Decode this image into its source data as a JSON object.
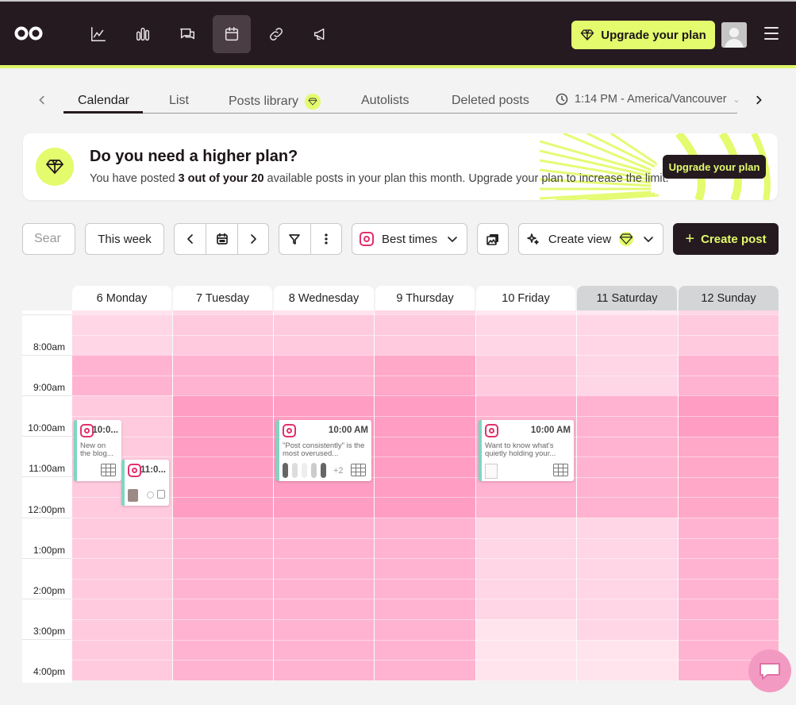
{
  "nav": {
    "upgrade_label": "Upgrade your plan",
    "icons": [
      "analytics-icon",
      "reports-icon",
      "inbox-icon",
      "calendar-icon",
      "link-icon",
      "megaphone-icon"
    ],
    "active": "calendar-icon"
  },
  "tabs": {
    "items": [
      "Calendar",
      "List",
      "Posts library",
      "Autolists",
      "Deleted posts"
    ],
    "active": "Calendar",
    "timezone": "1:14 PM - America/Vancouver"
  },
  "banner": {
    "title": "Do you need a higher plan?",
    "text_before": "You have posted ",
    "text_bold": "3 out of your 20",
    "text_after": " available posts in your plan this month. Upgrade your plan to increase the limit.",
    "button": "Upgrade your plan"
  },
  "toolbar": {
    "search_placeholder": "Sear",
    "range": "This week",
    "best_times": "Best times",
    "create_view": "Create view",
    "create_post": "Create post"
  },
  "calendar": {
    "days": [
      "6 Monday",
      "7 Tuesday",
      "8 Wednesday",
      "9 Thursday",
      "10 Friday",
      "11 Saturday",
      "12 Sunday"
    ],
    "weekend_days": [
      "11 Saturday",
      "12 Sunday"
    ],
    "time_labels": [
      "8:00am",
      "9:00am",
      "10:00am",
      "11:00am",
      "12:00pm",
      "1:00pm",
      "2:00pm",
      "3:00pm",
      "4:00pm"
    ],
    "posts": [
      {
        "day": "6 Monday",
        "time": "10:0...",
        "text": "New on the blog..."
      },
      {
        "day": "6 Monday",
        "time": "11:0..."
      },
      {
        "day": "8 Wednesday",
        "time": "10:00 AM",
        "text": "\"Post consistently\" is the most overused...",
        "more": "+2"
      },
      {
        "day": "10 Friday",
        "time": "10:00 AM",
        "text": "Want to know what's quietly holding your..."
      }
    ]
  },
  "colors": {
    "nav_bg": "#251a20",
    "accent": "#e3fb6c",
    "instagram": "#e1306c",
    "heat_low": "#ffd6e6",
    "heat_high": "#ff9dc2"
  }
}
